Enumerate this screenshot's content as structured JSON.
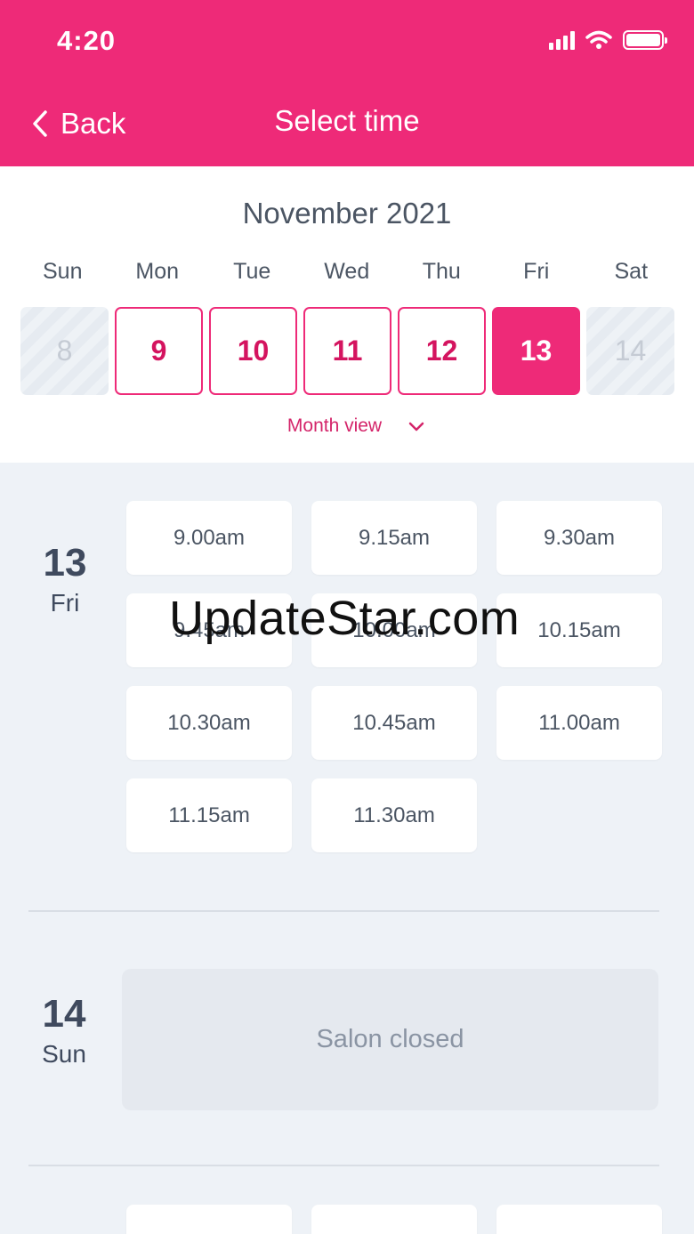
{
  "status_bar": {
    "time": "4:20"
  },
  "nav": {
    "back_label": "Back",
    "title": "Select time"
  },
  "calendar": {
    "month": "November 2021",
    "weekdays": [
      "Sun",
      "Mon",
      "Tue",
      "Wed",
      "Thu",
      "Fri",
      "Sat"
    ],
    "days": [
      {
        "num": "8",
        "state": "disabled"
      },
      {
        "num": "9",
        "state": "available"
      },
      {
        "num": "10",
        "state": "available"
      },
      {
        "num": "11",
        "state": "available"
      },
      {
        "num": "12",
        "state": "available"
      },
      {
        "num": "13",
        "state": "selected"
      },
      {
        "num": "14",
        "state": "disabled"
      }
    ],
    "toggle_label": "Month view"
  },
  "schedule": [
    {
      "day_num": "13",
      "day_name": "Fri",
      "slots": [
        "9.00am",
        "9.15am",
        "9.30am",
        "9.45am",
        "10.00am",
        "10.15am",
        "10.30am",
        "10.45am",
        "11.00am",
        "11.15am",
        "11.30am"
      ]
    },
    {
      "day_num": "14",
      "day_name": "Sun",
      "status": "Salon closed"
    }
  ],
  "watermark": "UpdateStar.com",
  "colors": {
    "brand_pink": "#ee2a78",
    "background": "#eef2f7"
  }
}
